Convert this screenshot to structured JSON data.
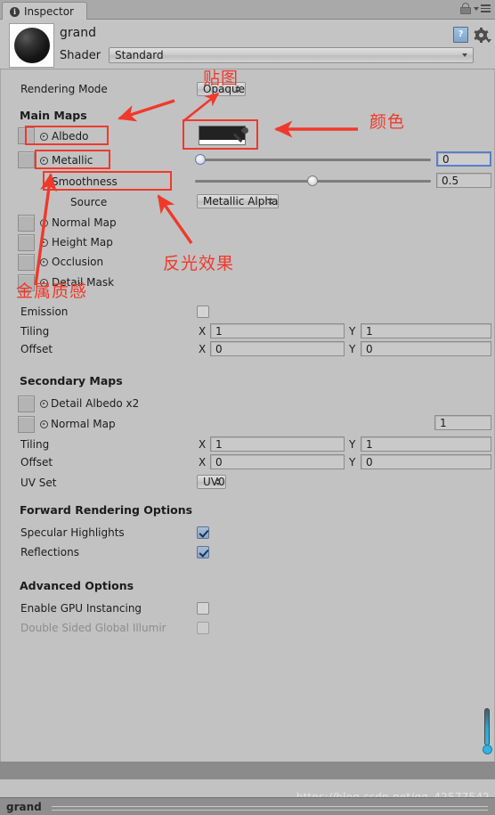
{
  "window": {
    "tab_label": "Inspector",
    "tab_icon": "info-circle-icon",
    "lock_icon": "lock-icon",
    "menu_icon": "hamburger-menu-icon"
  },
  "material": {
    "name": "grand",
    "shader_label": "Shader",
    "shader_value": "Standard",
    "help_icon": "help-book-icon",
    "settings_icon": "gear-icon",
    "preview_icon": "material-sphere-preview"
  },
  "rendering": {
    "mode_label": "Rendering Mode",
    "mode_value": "Opaque"
  },
  "main_maps": {
    "title": "Main Maps",
    "albedo_label": "Albedo",
    "metallic_label": "Metallic",
    "smoothness_label": "Smoothness",
    "source_label": "Source",
    "source_value": "Metallic Alpha",
    "normal_map_label": "Normal Map",
    "height_map_label": "Height Map",
    "occlusion_label": "Occlusion",
    "detail_mask_label": "Detail Mask",
    "emission_label": "Emission",
    "tiling_label": "Tiling",
    "offset_label": "Offset",
    "metallic_value": "0",
    "smoothness_value": "0.5",
    "tiling_x": "1",
    "tiling_y": "1",
    "offset_x": "0",
    "offset_y": "0",
    "x_axis": "X",
    "y_axis": "Y",
    "albedo_color": "#222222",
    "eyedropper_icon": "eyedropper-icon"
  },
  "secondary_maps": {
    "title": "Secondary Maps",
    "detail_albedo_label": "Detail Albedo x2",
    "normal_map_label": "Normal Map",
    "normal_scale_value": "1",
    "tiling_label": "Tiling",
    "offset_label": "Offset",
    "tiling_x": "1",
    "tiling_y": "1",
    "offset_x": "0",
    "offset_y": "0",
    "x_axis": "X",
    "y_axis": "Y",
    "uv_set_label": "UV Set",
    "uv_set_value": "UV0"
  },
  "forward_rendering": {
    "title": "Forward Rendering Options",
    "specular_label": "Specular Highlights",
    "specular_checked": true,
    "reflections_label": "Reflections",
    "reflections_checked": true
  },
  "advanced": {
    "title": "Advanced Options",
    "gpu_instancing_label": "Enable GPU Instancing",
    "gpu_instancing_checked": false,
    "double_sided_label": "Double Sided Global Illumir",
    "double_sided_checked": false
  },
  "status_bar": {
    "text": "grand"
  },
  "watermark": {
    "text": "https://blog.csdn.net/qq_42577542"
  },
  "annotations": {
    "accent_color": "#f0392b",
    "texture": "贴图",
    "color": "颜色",
    "reflection": "反光效果",
    "metallic_feel": "金属质感"
  }
}
